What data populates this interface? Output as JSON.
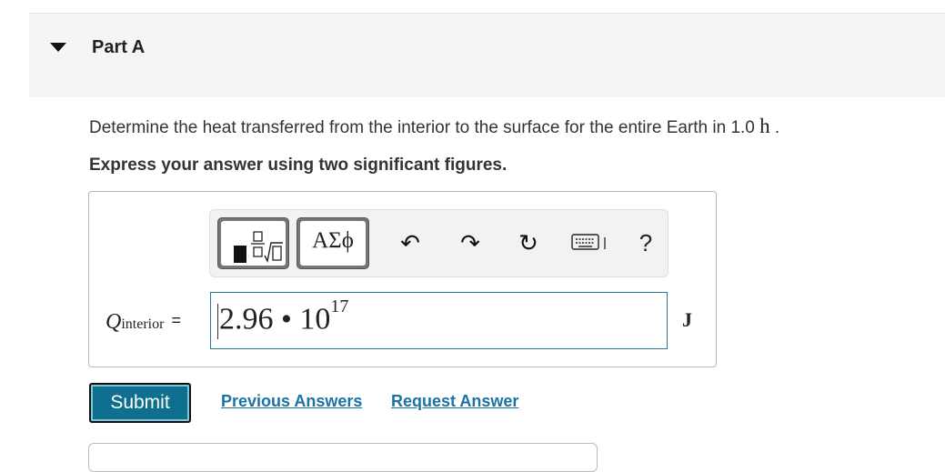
{
  "part": {
    "title": "Part A"
  },
  "question": {
    "text": "Determine the heat transferred from the interior to the surface for the entire Earth in 1.0 ",
    "unit": "h",
    "end": " ."
  },
  "instruction": "Express your answer using two significant figures.",
  "toolbar": {
    "symbols_label": "ΑΣϕ",
    "undo_glyph": "↶",
    "redo_glyph": "↷",
    "reset_glyph": "↻",
    "help_label": "?"
  },
  "answer": {
    "variable": "Q",
    "subscript": "interior",
    "equals": "=",
    "mantissa": "2.96 • 10",
    "exponent": "17",
    "unit": "J"
  },
  "actions": {
    "submit": "Submit",
    "previous_answers": "Previous Answers",
    "request_answer": "Request Answer"
  }
}
